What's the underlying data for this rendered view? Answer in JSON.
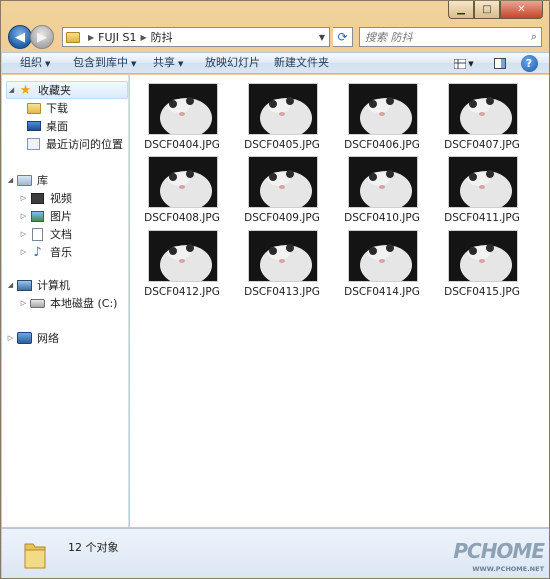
{
  "window": {
    "caption_buttons": [
      "minimize",
      "maximize",
      "close"
    ]
  },
  "navigation": {
    "breadcrumbs": [
      "FUJI S1",
      "防抖"
    ],
    "search_placeholder": "搜索 防抖"
  },
  "toolbar": {
    "organize": "组织",
    "include_in_library": "包含到库中",
    "share": "共享",
    "slideshow": "放映幻灯片",
    "new_folder": "新建文件夹",
    "help_label": "?"
  },
  "sidebar": {
    "favorites": {
      "label": "收藏夹",
      "items": [
        {
          "label": "下载",
          "icon": "folder-download-icon"
        },
        {
          "label": "桌面",
          "icon": "desktop-icon"
        },
        {
          "label": "最近访问的位置",
          "icon": "recent-places-icon"
        }
      ]
    },
    "libraries": {
      "label": "库",
      "items": [
        {
          "label": "视频",
          "icon": "video-icon"
        },
        {
          "label": "图片",
          "icon": "pictures-icon"
        },
        {
          "label": "文档",
          "icon": "documents-icon"
        },
        {
          "label": "音乐",
          "icon": "music-icon"
        }
      ]
    },
    "computer": {
      "label": "计算机",
      "items": [
        {
          "label": "本地磁盘 (C:)",
          "icon": "drive-icon"
        }
      ]
    },
    "network": {
      "label": "网络"
    }
  },
  "files": [
    {
      "name": "DSCF0404.JPG"
    },
    {
      "name": "DSCF0405.JPG"
    },
    {
      "name": "DSCF0406.JPG"
    },
    {
      "name": "DSCF0407.JPG"
    },
    {
      "name": "DSCF0408.JPG"
    },
    {
      "name": "DSCF0409.JPG"
    },
    {
      "name": "DSCF0410.JPG"
    },
    {
      "name": "DSCF0411.JPG"
    },
    {
      "name": "DSCF0412.JPG"
    },
    {
      "name": "DSCF0413.JPG"
    },
    {
      "name": "DSCF0414.JPG"
    },
    {
      "name": "DSCF0415.JPG"
    }
  ],
  "status": {
    "count": "12 个对象"
  },
  "watermark": {
    "logo": "PCHOME",
    "url": "WWW.PCHOME.NET"
  },
  "colors": {
    "window_frame": "#e9c98e",
    "toolbar": "#dae6f3",
    "selection": "#dbeafb",
    "accent": "#1f5fa8"
  }
}
